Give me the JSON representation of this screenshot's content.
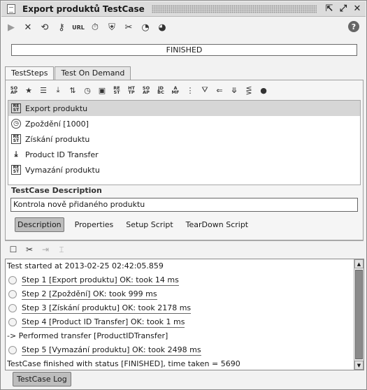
{
  "window": {
    "title": "Export produktů TestCase"
  },
  "toolbar": {
    "items": [
      "run-icon",
      "cancel-icon",
      "loop-icon",
      "key-icon",
      "URL",
      "timer-icon",
      "shield-icon",
      "tools-icon",
      "clock-icon",
      "clock-icon"
    ],
    "url_label": "URL",
    "help_label": "?"
  },
  "status": {
    "text": "FINISHED"
  },
  "tabs": {
    "test_steps": "TestSteps",
    "test_on_demand": "Test On Demand"
  },
  "steps": [
    {
      "label": "Export produktu",
      "icon": "rest-icon",
      "selected": true
    },
    {
      "label": "Zpoždění [1000]",
      "icon": "delay-icon",
      "selected": false
    },
    {
      "label": "Získání produktu",
      "icon": "rest-icon",
      "selected": false
    },
    {
      "label": "Product ID Transfer",
      "icon": "transfer-icon",
      "selected": false
    },
    {
      "label": "Vymazání produktu",
      "icon": "rest-icon",
      "selected": false
    }
  ],
  "description": {
    "label": "TestCase Description",
    "value": "Kontrola nově přidaného produktu",
    "tabs": [
      "Description",
      "Properties",
      "Setup Script",
      "TearDown Script"
    ]
  },
  "log": {
    "lines": [
      {
        "kind": "text",
        "text": "Test started at 2013-02-25 02:42:05.859"
      },
      {
        "kind": "step",
        "text": "Step 1 [Export produktu] OK: took 14 ms"
      },
      {
        "kind": "step",
        "text": "Step 2 [Zpoždění] OK: took 999 ms"
      },
      {
        "kind": "step",
        "text": "Step 3 [Získání produktu] OK: took 2178 ms"
      },
      {
        "kind": "step",
        "text": "Step 4 [Product ID Transfer] OK: took 1 ms"
      },
      {
        "kind": "text",
        "text": "-> Performed transfer [ProductIDTransfer]"
      },
      {
        "kind": "step",
        "text": "Step 5 [Vymazání produktu] OK: took 2498 ms"
      },
      {
        "kind": "text",
        "text": "TestCase finished with status [FINISHED], time taken = 5690"
      }
    ],
    "button_label": "TestCase Log"
  }
}
